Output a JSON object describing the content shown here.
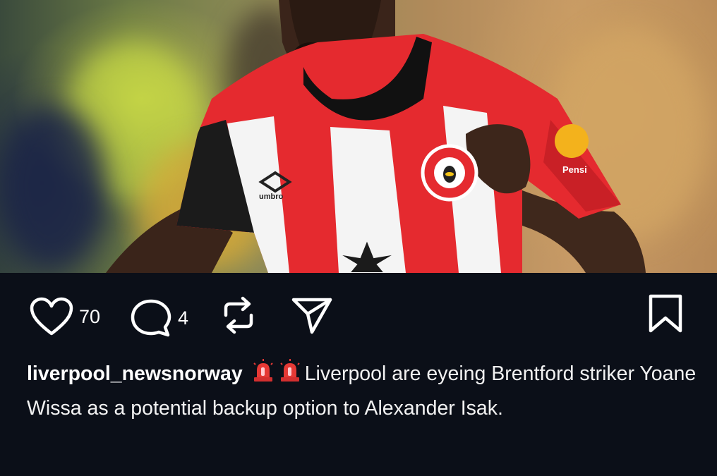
{
  "post": {
    "image_alt_subject": "footballer in red and white striped kit",
    "kit_brand": "umbro",
    "club_badge": "BRENTFORD FOOTBALL CLUB",
    "sleeve_sponsor": "Pensi"
  },
  "actions": {
    "likes": "70",
    "comments": "4",
    "icons": [
      "heart-icon",
      "comment-icon",
      "repost-icon",
      "share-icon",
      "bookmark-icon"
    ]
  },
  "caption": {
    "username": "liverpool_newsnorway",
    "emoji": "🚨🚨",
    "text": "Liverpool are eyeing Brentford striker Yoane Wissa as a potential backup option to Alexander Isak."
  },
  "colors": {
    "background": "#0b0f18",
    "text": "#ffffff",
    "kit_red": "#e52a2f"
  }
}
